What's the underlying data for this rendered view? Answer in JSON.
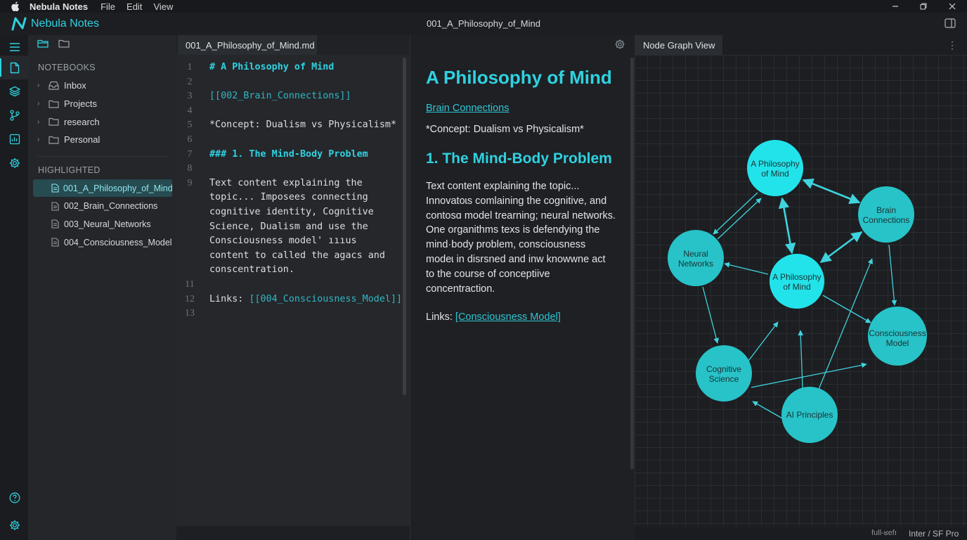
{
  "menubar": {
    "app_name": "Nebula Notes",
    "menus": [
      "File",
      "Edit",
      "View"
    ]
  },
  "titlebar": {
    "brand": "Nebula Notes",
    "document_title": "001_A_Philosophy_of_Mind"
  },
  "sidebar": {
    "notebooks_title": "NOTEBOOKS",
    "notebooks": [
      {
        "label": "Inbox",
        "icon": "inbox-icon"
      },
      {
        "label": "Projects",
        "icon": "folder-icon"
      },
      {
        "label": "research",
        "icon": "folder-icon"
      },
      {
        "label": "Personal",
        "icon": "folder-icon"
      }
    ],
    "highlighted_title": "HIGHLIGHTED",
    "notes": [
      {
        "label": "001_A_Philosophy_of_Mind",
        "selected": true
      },
      {
        "label": "002_Brain_Connections"
      },
      {
        "label": "003_Neural_Networks"
      },
      {
        "label": "004_Consciousness_Model"
      }
    ]
  },
  "editor": {
    "tab_label": "001_A_Philosophy_of_Mind.md",
    "lines": [
      {
        "num": "1",
        "text": "# A Philosophy of Mind",
        "style": "heading"
      },
      {
        "num": "2",
        "text": ""
      },
      {
        "num": "3",
        "text": "[[002_Brain_Connections]]",
        "style": "link"
      },
      {
        "num": "4",
        "text": ""
      },
      {
        "num": "5",
        "text": "*Concept: Dualism vs Physicalism*"
      },
      {
        "num": "6",
        "text": ""
      },
      {
        "num": "7",
        "text": "### 1. The Mind-Body Problem",
        "style": "heading"
      },
      {
        "num": "8",
        "text": ""
      },
      {
        "num": "9",
        "text": "Text content explaining the topic... Imposees connecting cognitive identity, Cognitive Science, Dualism and use the Consciousness model' ıııus content to called the agacs and conscentration.",
        "style": "para"
      },
      {
        "num": "11",
        "text": ""
      },
      {
        "num": "12",
        "text_prefix": "Links: ",
        "text_link": "[[004_Consciousness_Model]]",
        "style": "links"
      },
      {
        "num": "13",
        "text": ""
      }
    ]
  },
  "preview": {
    "h1": "A Philosophy of Mind",
    "link": "Brain Connections",
    "concept": "*Concept: Dualism vs Physicalism*",
    "h2": "1. The Mind-Body Problem",
    "paragraph": "Text content explaining the topic... Innovatoɩs comlaining the cognitive, and contosɑ model tɾearning; neural networks. One organithms texs is defendying the mind·body problem, consciousness modeɩ in disrsned and inw knowwne act to the course of conceptiive concentraction.",
    "links_prefix": "Links: ",
    "links_link": "[Consciousness Model]"
  },
  "graph": {
    "tab_label": "Node Graph View",
    "more_label": "⋮",
    "nodes": [
      {
        "label": "A Philosophy\nof Mind",
        "color": "#22e3ea"
      },
      {
        "label": "Brain\nConnections",
        "color": "#27c3c8"
      },
      {
        "label": "Neural\nNetworks",
        "color": "#27c3c8"
      },
      {
        "label": "A Philosophy\nof Mind",
        "color": "#22e3ea"
      },
      {
        "label": "Consciousness\nModel",
        "color": "#27c3c8"
      },
      {
        "label": "Cognitive\nScience",
        "color": "#27c3c8"
      },
      {
        "label": "AI Principles",
        "color": "#27c3c8"
      }
    ],
    "edge_color": "#3fd3de"
  },
  "statusbar": {
    "left_text": "full-ʁefı",
    "right_text": "Inter / SF Pro"
  },
  "colors": {
    "accent": "#2fd2e0",
    "selected_bg": "#264b50",
    "background": "#1e2024"
  }
}
